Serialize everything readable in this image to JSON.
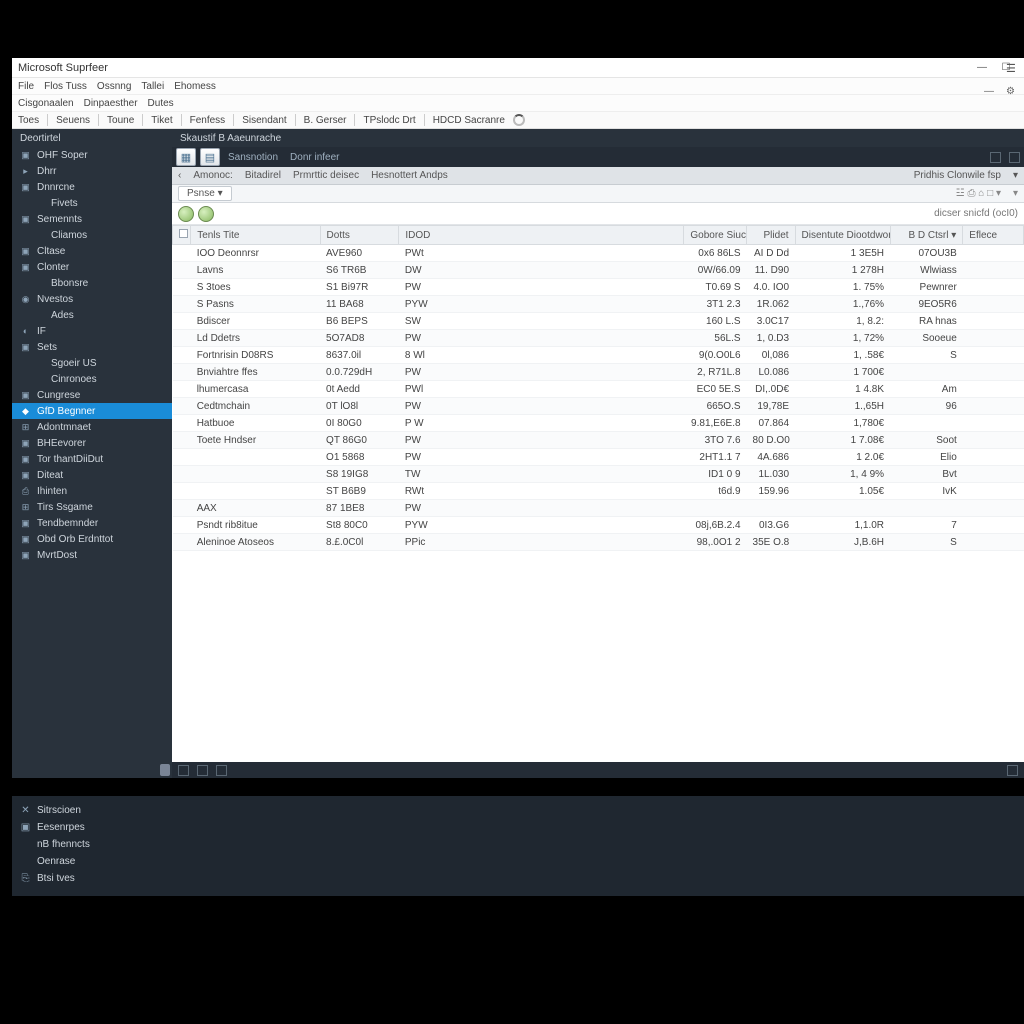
{
  "window": {
    "title": "Microsoft Suprfeer",
    "min": "—",
    "max": "☐",
    "close": "✕"
  },
  "menubar1": [
    "File",
    "Flos  Tuss",
    "Ossnng",
    "Tallei",
    "Ehomess"
  ],
  "menubar2": [
    "Cisgonaalen",
    "Dinpaesther",
    "Dutes"
  ],
  "toolrow": [
    "Toes",
    "Seuens",
    "Toune",
    "Tiket",
    "Fenfess",
    "Sisendant",
    "B. Gerser",
    "TPslodc Drt",
    "HDCD Sacranre"
  ],
  "darkstrip": {
    "left": "Deortirtel",
    "right": "Skaustif B Aaeunrache"
  },
  "sidebar": {
    "items": [
      {
        "icon": "▣",
        "label": "OHF Soper"
      },
      {
        "icon": "▸",
        "label": "Dhrr"
      },
      {
        "icon": "▣",
        "label": "Dnnrcne"
      },
      {
        "icon": "",
        "label": "Fivets",
        "indent": true
      },
      {
        "icon": "▣",
        "label": "Semennts"
      },
      {
        "icon": "",
        "label": "Cliamos",
        "indent": true
      },
      {
        "icon": "▣",
        "label": "Cltase"
      },
      {
        "icon": "▣",
        "label": "Clonter"
      },
      {
        "icon": "",
        "label": "Bbonsre",
        "indent": true
      },
      {
        "icon": "◉",
        "label": "Nvestos"
      },
      {
        "icon": "",
        "label": "Ades",
        "indent": true
      },
      {
        "icon": "◐",
        "label": "IF"
      },
      {
        "icon": "▣",
        "label": "Sets"
      },
      {
        "icon": "",
        "label": "Sgoeir US",
        "indent": true
      },
      {
        "icon": "",
        "label": "Cinronoes",
        "indent": true
      },
      {
        "icon": "▣",
        "label": "Cungrese"
      },
      {
        "icon": "◆",
        "label": "GfD Begnner",
        "selected": true
      },
      {
        "icon": "⊞",
        "label": "Adontmnaet"
      },
      {
        "icon": "▣",
        "label": "BHEevorer"
      },
      {
        "icon": "▣",
        "label": "Tor thantDiiDut"
      },
      {
        "icon": "▣",
        "label": "Diteat"
      },
      {
        "icon": "⎙",
        "label": "Ihinten"
      },
      {
        "icon": "⊞",
        "label": "Tirs Ssgame"
      },
      {
        "icon": "▣",
        "label": "Tendbemnder"
      },
      {
        "icon": "▣",
        "label": "Obd Orb Erdnttot"
      },
      {
        "icon": "▣",
        "label": "MvrtDost"
      }
    ]
  },
  "main": {
    "topbar": {
      "labels": [
        "Sansnotion",
        "Donr infeer"
      ]
    },
    "tabs": [
      "Amonoc:",
      "Bitadirel",
      "Prmrttic deisec",
      "Hesnottert Andps"
    ],
    "tabs_right": "Pridhis Clonwile fsp",
    "subbar": {
      "pill": "Psnse ▾",
      "right_controls": [
        "☳",
        "⎙",
        "⌂",
        "□",
        "▾"
      ]
    },
    "iconrow_right": "dicser snicfd (ocI0)",
    "columns": [
      "",
      "Tenls   Tite",
      "Dotts",
      "IDOD",
      "Gobore Siucl",
      "Plidet",
      "Disentute Diootdwords",
      "B  D Ctsrl ▾",
      "Eflece"
    ],
    "rows": [
      {
        "name": "IOO Deonnrsr",
        "date": "AVE960",
        "idd": "PWt",
        "gf": "0x6 86LS",
        "pl": "AI D Dd",
        "db": "1 3E5H",
        "bc": "07OU3B",
        "ef": ""
      },
      {
        "name": "Lavns",
        "date": "S6 TR6B",
        "idd": "DW",
        "gf": "0W/66.09",
        "pl": "11. D90",
        "db": "1 278H",
        "bc": "Wlwiass",
        "ef": ""
      },
      {
        "name": "S 3toes",
        "date": "S1 Bi97R",
        "idd": "PW",
        "gf": "T0.69 S",
        "pl": "4.0. IO0",
        "db": "1. 75%",
        "bc": "Pewnrer",
        "ef": ""
      },
      {
        "name": "S Pasns",
        "date": "11 BA68",
        "idd": "PYW",
        "gf": "3T1 2.3",
        "pl": "1R.062",
        "db": "1.,76%",
        "bc": "9EO5R6",
        "ef": ""
      },
      {
        "name": "Bdiscer",
        "date": "B6 BEPS",
        "idd": "SW",
        "gf": "160 L.S",
        "pl": "3.0C17",
        "db": "1, 8.2:",
        "bc": "RA hnas",
        "ef": ""
      },
      {
        "name": "Ld Ddetrs",
        "date": "5O7AD8",
        "idd": "PW",
        "gf": "56L.S",
        "pl": "1, 0.D3",
        "db": "1, 72%",
        "bc": "Sooeue",
        "ef": ""
      },
      {
        "name": "Fortnrisin D08RS",
        "date": "8637.0il",
        "idd": "8 Wl",
        "gf": "9(0.O0L6",
        "pl": "0l,086",
        "db": "1, .58€",
        "bc": "S",
        "ef": ""
      },
      {
        "name": "Bnviahtre ffes",
        "date": "0.0.729dH",
        "idd": "PW",
        "gf": "2, R71L.8",
        "pl": "L0.086",
        "db": "1 700€",
        "bc": "",
        "ef": ""
      },
      {
        "name": "lhumercasa",
        "date": "0t Aedd",
        "idd": "PWl",
        "gf": "EC0 5E.S",
        "pl": "DI,.0D€",
        "db": "1 4.8K",
        "bc": "Am",
        "ef": ""
      },
      {
        "name": "Cedtmchain",
        "date": "0T lO8l",
        "idd": "PW",
        "gf": "665O.S",
        "pl": "19,78E",
        "db": "1.,65H",
        "bc": "96",
        "ef": ""
      },
      {
        "name": "Hatbuoe",
        "date": "0I 80G0",
        "idd": "P W",
        "gf": "9.81,E6E.8",
        "pl": "07.864",
        "db": "1,780€",
        "bc": "",
        "ef": ""
      },
      {
        "name": "Toete Hndser",
        "date": "QT 86G0",
        "idd": "PW",
        "gf": "3TO 7.6",
        "pl": "80 D.O0",
        "db": "1 7.08€",
        "bc": "Soot",
        "ef": ""
      },
      {
        "name": "",
        "date": "O1 5868",
        "idd": "PW",
        "gf": "2HT1.1 7",
        "pl": "4A.686",
        "db": "1 2.0€",
        "bc": "Elio",
        "ef": ""
      },
      {
        "name": "",
        "date": "S8 19IG8",
        "idd": "TW",
        "gf": "ID1 0 9",
        "pl": "1L.030",
        "db": "1, 4 9%",
        "bc": "Bvt",
        "ef": ""
      },
      {
        "name": "",
        "date": "ST B6B9",
        "idd": "RWt",
        "gf": "t6d.9",
        "pl": "159.96",
        "db": "1.05€",
        "bc": "IvK",
        "ef": ""
      },
      {
        "name": "AAX",
        "date": "87 1BE8",
        "idd": "PW",
        "gf": "",
        "pl": "",
        "db": "",
        "bc": "",
        "ef": ""
      },
      {
        "name": "Psndt rib8itue",
        "date": "St8 80C0",
        "idd": "PYW",
        "gf": "08j,6B.2.4",
        "pl": "0I3.G6",
        "db": "1,1.0R",
        "bc": "7",
        "ef": ""
      },
      {
        "name": "Aleninoe Atoseos",
        "date": "8.£.0C0l",
        "idd": "PPic",
        "gf": "98,.0O1 2",
        "pl": "35E O.8",
        "db": "J,B.6H",
        "bc": "S",
        "ef": ""
      }
    ]
  },
  "lowerpanel": {
    "items": [
      {
        "icon": "✕",
        "label": "Sitrscioen"
      },
      {
        "icon": "▣",
        "label": "Eesenrpes"
      },
      {
        "icon": "",
        "label": "nB fhenncts"
      },
      {
        "icon": "",
        "label": "Oenrase"
      },
      {
        "icon": "⎘",
        "label": "Btsi  tves"
      }
    ]
  }
}
